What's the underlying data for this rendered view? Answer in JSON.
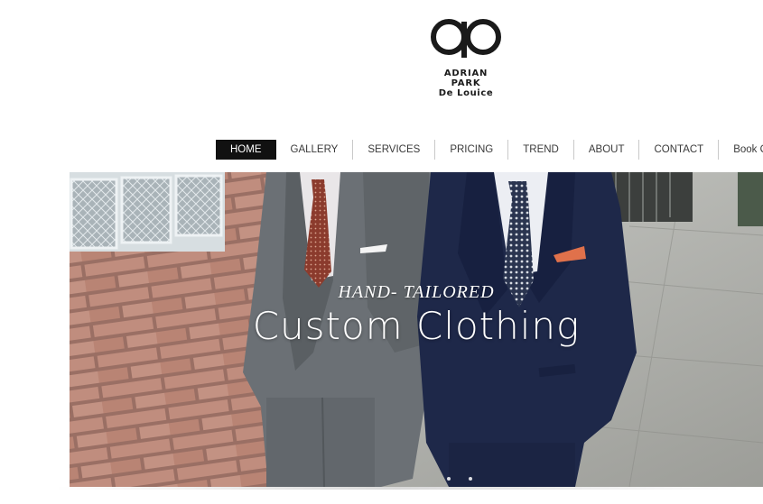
{
  "brand": {
    "logo_icon": "ap-monogram-icon",
    "line1": "ADRIAN PARK",
    "line2": "De Louice"
  },
  "nav": {
    "items": [
      {
        "label": "HOME",
        "active": true
      },
      {
        "label": "GALLERY"
      },
      {
        "label": "SERVICES"
      },
      {
        "label": "PRICING"
      },
      {
        "label": "TREND"
      },
      {
        "label": "ABOUT"
      },
      {
        "label": "CONTACT"
      },
      {
        "label": "Book Online"
      }
    ]
  },
  "hero": {
    "tagline": "HAND- TAILORED",
    "title": "Custom Clothing",
    "slides": 2
  },
  "colors": {
    "accent": "#111111",
    "nav_text": "#3a3a3a",
    "brick": "#b97e6c",
    "navy_suit": "#1f2a4d",
    "grey_suit": "#6f7478"
  }
}
